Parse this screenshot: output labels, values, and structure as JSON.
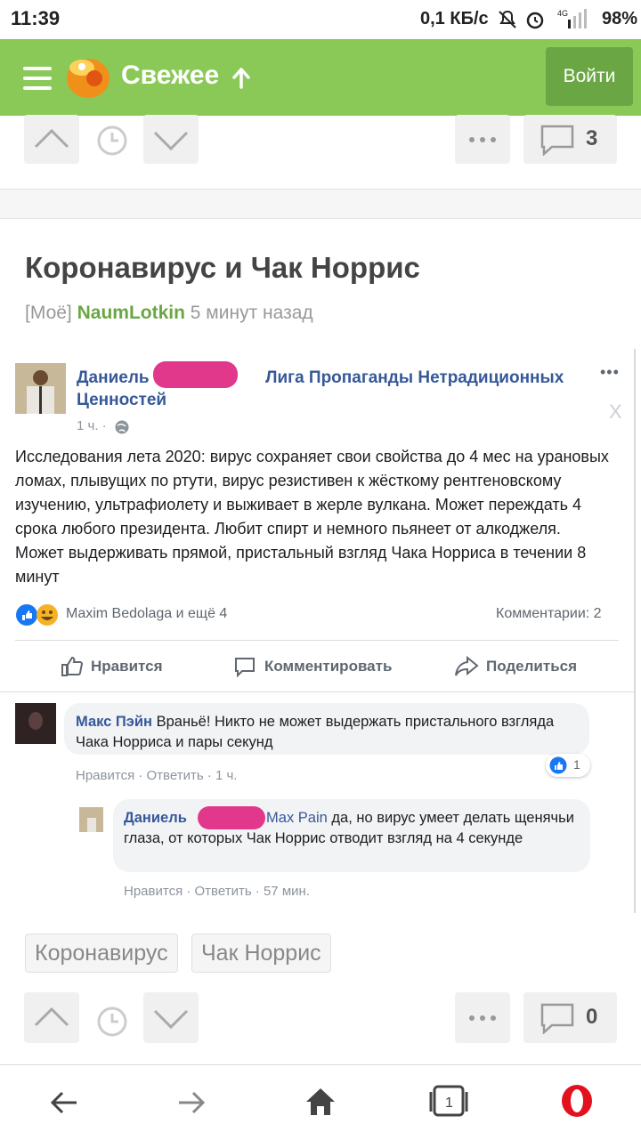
{
  "status": {
    "time": "11:39",
    "network": "0,1 КБ/с",
    "battery": "98%"
  },
  "header": {
    "title": "Свежее",
    "login": "Войти"
  },
  "post": {
    "comments_count_top": "3",
    "title": "Коронавирус и Чак Норрис",
    "community": "[Моё]",
    "author": "NaumLotkin",
    "time": "5 минут назад",
    "tags": [
      "Коронавирус",
      "Чак Норрис"
    ],
    "comments_count_bottom": "0"
  },
  "fb": {
    "poster": "Даниель",
    "group": "Лига Пропаганды Нетрадиционных Ценностей",
    "post_time": "1 ч. ·",
    "close": "X",
    "more": "•••",
    "text": "Исследования лета 2020: вирус сохраняет свои свойства до 4 мес на урановых ломах, плывущих по ртути, вирус резистивен к жёсткому рентгеновскому изучению, ультрафиолету и выживает в жерле вулкана. Может переждать 4 срока любого президента. Любит спирт и немного пьянеет от алкоджеля. Может выдерживать прямой, пристальный взгляд Чака Норриса в течении 8 минут",
    "reactions": "Maxim Bedolaga и ещё 4",
    "comments_label": "Комментарии: 2",
    "actions": {
      "like": "Нравится",
      "comment": "Комментировать",
      "share": "Поделиться"
    },
    "comment1": {
      "name": "Макс Пэйн",
      "text": "Враньё! Никто не может выдержать пристального взгляда Чака Норриса и пары секунд",
      "meta": "Нравится · Ответить · 1 ч.",
      "likes": "1"
    },
    "comment2": {
      "name": "Даниель",
      "mention": "Max Pain",
      "text": "да, но вирус умеет делать щенячьи глаза, от которых Чак Норрис отводит взгляд на 4 секунде",
      "meta": "Нравится · Ответить · 57 мин."
    }
  },
  "colors": {
    "header_green": "#8ac858",
    "login_green": "#6aa744",
    "fb_blue": "#365899",
    "censor_pink": "#e2388c"
  }
}
